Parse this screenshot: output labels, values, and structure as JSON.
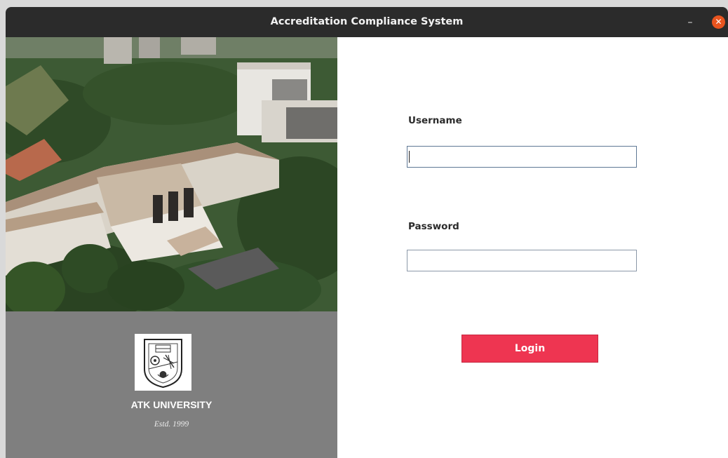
{
  "window": {
    "title": "Accreditation Compliance System",
    "minimize_glyph": "–",
    "close_glyph": "✕"
  },
  "branding": {
    "university_name": "ATK UNIVERSITY",
    "established": "Estd. 1999",
    "campus_photo": "aerial-campus-photo",
    "emblem": "university-crest-icon"
  },
  "login_form": {
    "username_label": "Username",
    "username_value": "",
    "password_label": "Password",
    "password_value": "",
    "login_label": "Login"
  },
  "colors": {
    "titlebar": "#2b2b2b",
    "close_button": "#e9541f",
    "brand_panel": "#7f7f7f",
    "login_button": "#ee3551"
  }
}
